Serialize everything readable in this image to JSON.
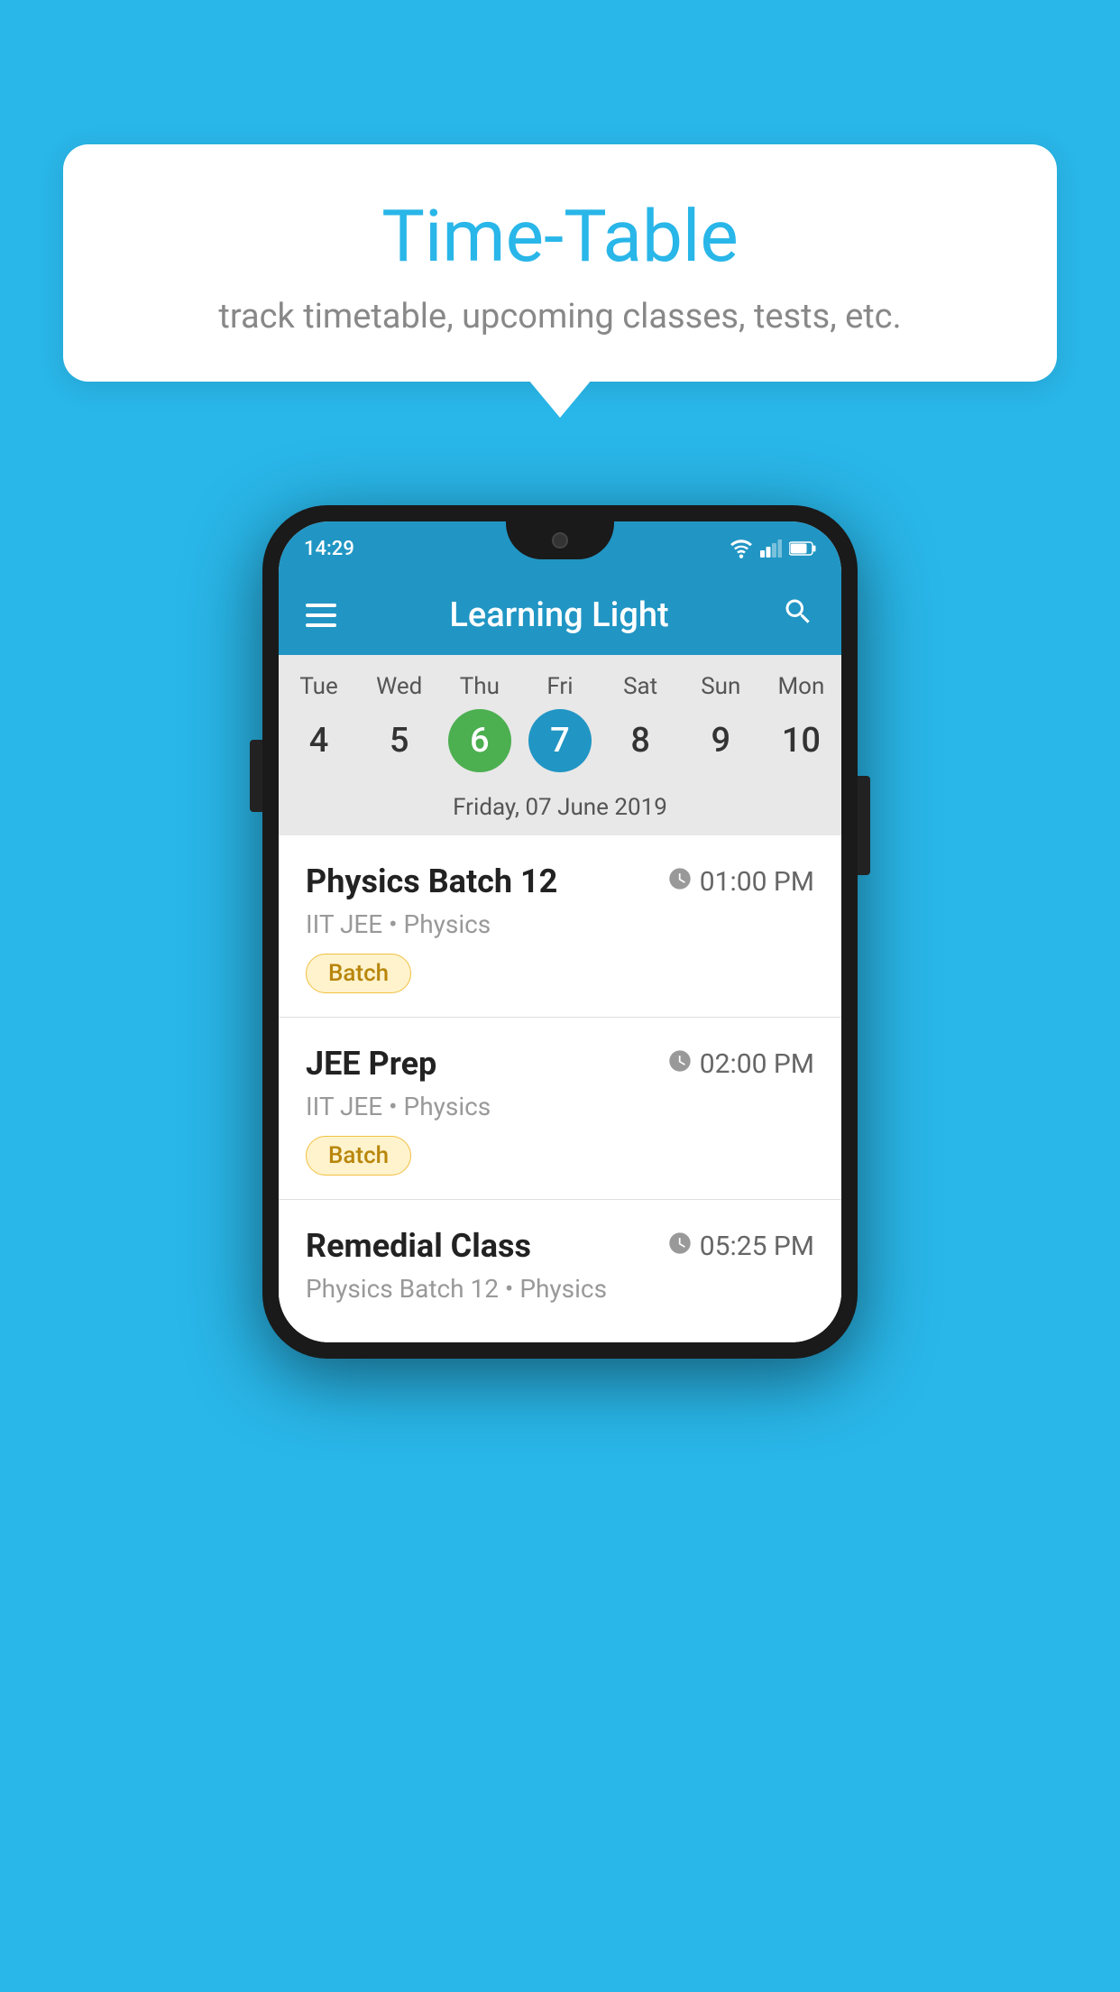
{
  "background": {
    "color": "#29b6e8"
  },
  "tooltip": {
    "title": "Time-Table",
    "subtitle": "track timetable, upcoming classes, tests, etc."
  },
  "phone": {
    "status_bar": {
      "time": "14:29"
    },
    "app_bar": {
      "title": "Learning Light",
      "menu_icon": "hamburger",
      "search_icon": "search"
    },
    "calendar": {
      "days": [
        "Tue",
        "Wed",
        "Thu",
        "Fri",
        "Sat",
        "Sun",
        "Mon"
      ],
      "dates": [
        4,
        5,
        6,
        7,
        8,
        9,
        10
      ],
      "today_index": 2,
      "selected_index": 3,
      "selected_label": "Friday, 07 June 2019"
    },
    "schedule": [
      {
        "title": "Physics Batch 12",
        "time": "01:00 PM",
        "subtitle": "IIT JEE • Physics",
        "tag": "Batch"
      },
      {
        "title": "JEE Prep",
        "time": "02:00 PM",
        "subtitle": "IIT JEE • Physics",
        "tag": "Batch"
      },
      {
        "title": "Remedial Class",
        "time": "05:25 PM",
        "subtitle": "Physics Batch 12 • Physics",
        "tag": null
      }
    ]
  }
}
